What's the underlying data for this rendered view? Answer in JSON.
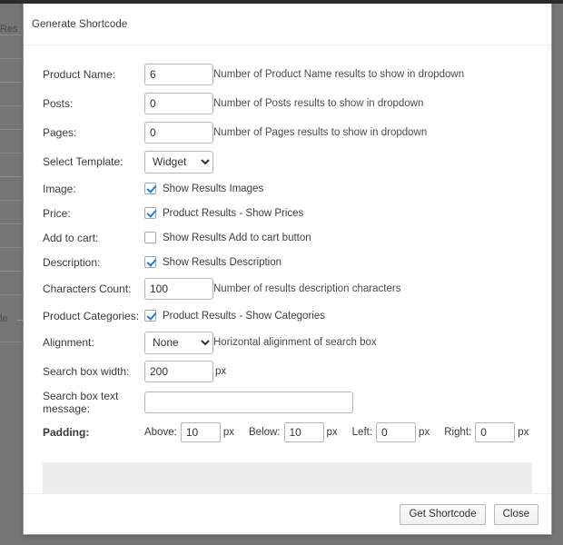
{
  "background": {
    "left_text_top": "Res",
    "left_text_mid": "le"
  },
  "modal": {
    "title": "Generate Shortcode",
    "rows": [
      {
        "id": "product-name",
        "label": "Product Name:",
        "type": "text",
        "value": "6",
        "hint": "Number of Product Name results to show in dropdown"
      },
      {
        "id": "posts",
        "label": "Posts:",
        "type": "text",
        "value": "0",
        "hint": "Number of Posts results to show in dropdown"
      },
      {
        "id": "pages",
        "label": "Pages:",
        "type": "text",
        "value": "0",
        "hint": "Number of Pages results to show in dropdown"
      },
      {
        "id": "select-template",
        "label": "Select Template:",
        "type": "select",
        "value": "Widget",
        "options": [
          "Widget"
        ],
        "hint": ""
      },
      {
        "id": "image",
        "label": "Image:",
        "type": "checkbox",
        "checked": true,
        "checkbox_label": "Show Results Images"
      },
      {
        "id": "price",
        "label": "Price:",
        "type": "checkbox",
        "checked": true,
        "checkbox_label": "Product Results - Show Prices"
      },
      {
        "id": "add-to-cart",
        "label": "Add to cart:",
        "type": "checkbox",
        "checked": false,
        "checkbox_label": "Show Results Add to cart button"
      },
      {
        "id": "description",
        "label": "Description:",
        "type": "checkbox",
        "checked": true,
        "checkbox_label": "Show Results Description"
      },
      {
        "id": "characters-count",
        "label": "Characters Count:",
        "type": "text",
        "value": "100",
        "hint": "Number of results description characters"
      },
      {
        "id": "product-categories",
        "label": "Product Categories:",
        "type": "checkbox",
        "checked": true,
        "checkbox_label": "Product Results - Show Categories"
      },
      {
        "id": "alignment",
        "label": "Alignment:",
        "type": "select",
        "value": "None",
        "options": [
          "None"
        ],
        "hint": "Horizontal aliginment of search box"
      },
      {
        "id": "search-box-width",
        "label": "Search box width:",
        "type": "text-unit",
        "value": "200",
        "unit": "px",
        "hint": ""
      },
      {
        "id": "search-box-text-message",
        "label": "Search box text message:",
        "type": "text-wide",
        "value": "",
        "placeholder": "",
        "hint": ""
      }
    ],
    "padding": {
      "label": "Padding:",
      "fields": [
        {
          "id": "above",
          "name": "Above:",
          "value": "10",
          "unit": "px"
        },
        {
          "id": "below",
          "name": "Below:",
          "value": "10",
          "unit": "px"
        },
        {
          "id": "left",
          "name": "Left:",
          "value": "0",
          "unit": "px"
        },
        {
          "id": "right",
          "name": "Right:",
          "value": "0",
          "unit": "px"
        }
      ]
    },
    "output": {
      "value": ""
    },
    "footer": {
      "get_shortcode_label": "Get Shortcode",
      "close_label": "Close"
    }
  },
  "colors": {
    "overlay": "#767676",
    "modal_bg": "#ffffff",
    "checkbox_accent": "#2a76d2",
    "output_bg": "#ececec"
  }
}
